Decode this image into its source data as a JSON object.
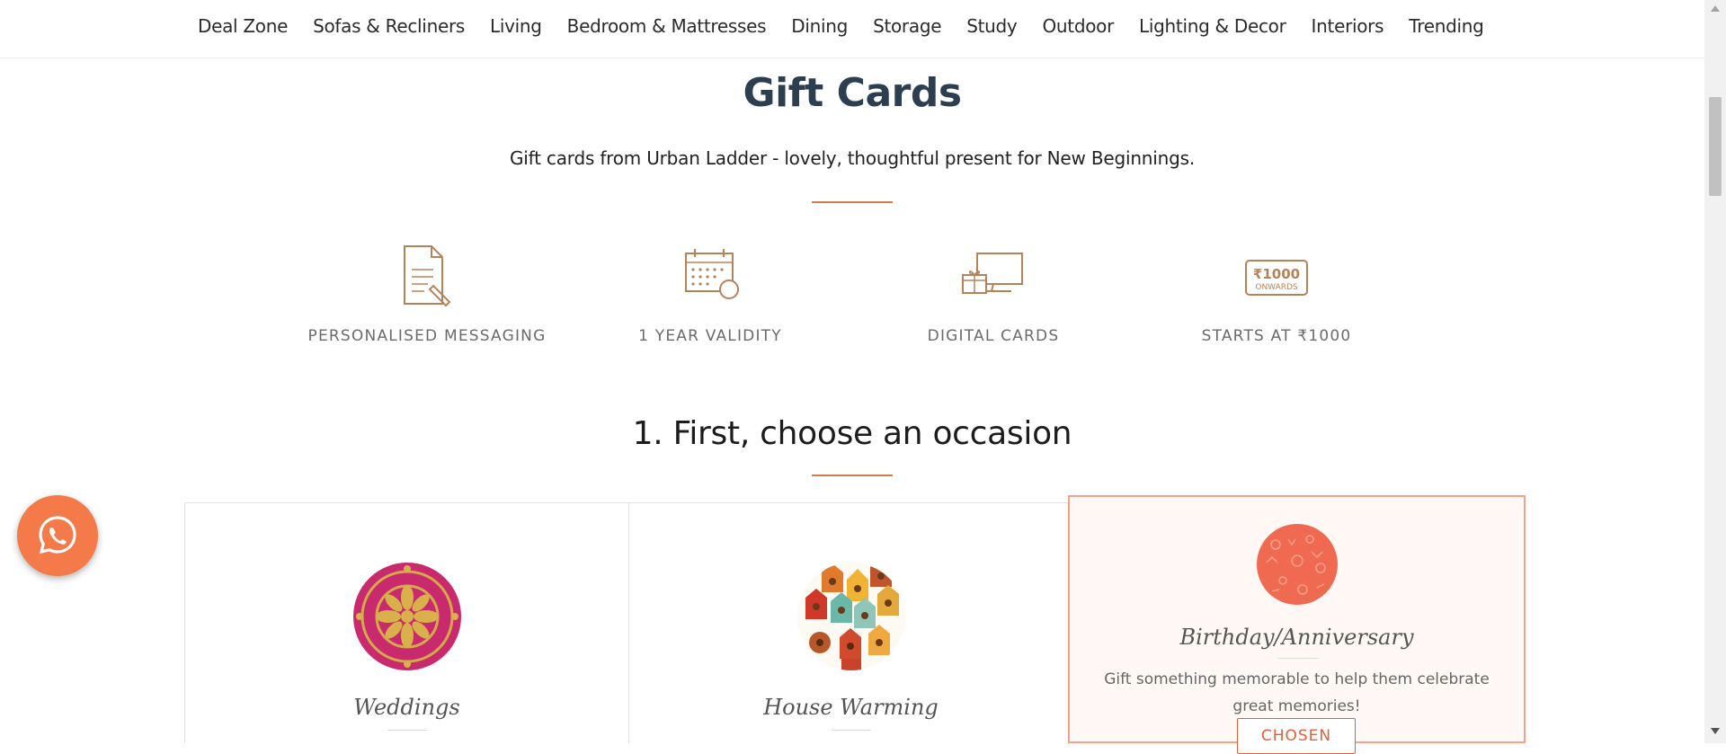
{
  "nav": {
    "items": [
      "Deal Zone",
      "Sofas & Recliners",
      "Living",
      "Bedroom & Mattresses",
      "Dining",
      "Storage",
      "Study",
      "Outdoor",
      "Lighting & Decor",
      "Interiors",
      "Trending"
    ]
  },
  "header": {
    "title": "Gift Cards",
    "subtitle": "Gift cards from Urban Ladder - lovely, thoughtful present for New Beginnings."
  },
  "features": [
    {
      "label": "PERSONALISED MESSAGING",
      "icon": "document-pen-icon"
    },
    {
      "label": "1 YEAR VALIDITY",
      "icon": "calendar-icon"
    },
    {
      "label": "DIGITAL CARDS",
      "icon": "gift-monitor-icon"
    },
    {
      "label": "STARTS AT ₹1000",
      "icon": "price-tag-icon",
      "badge_amount": "₹1000",
      "badge_text": "ONWARDS"
    }
  ],
  "step1": {
    "title": "1. First, choose an occasion"
  },
  "occasions": [
    {
      "name": "Weddings",
      "icon": "wedding-pattern-image"
    },
    {
      "name": "House Warming",
      "icon": "birdhouse-pattern-image"
    },
    {
      "name": "Birthday/Anniversary",
      "icon": "birthday-pattern-image",
      "description": "Gift something memorable to help them celebrate great memories!",
      "button": "CHOSEN",
      "selected": true
    }
  ],
  "colors": {
    "accent": "#d9784d",
    "title": "#2c3e50",
    "icon": "#b5835a",
    "whatsapp": "#f47a4a",
    "selected_border": "#f4a28c",
    "selected_bg": "#fff8f4"
  }
}
